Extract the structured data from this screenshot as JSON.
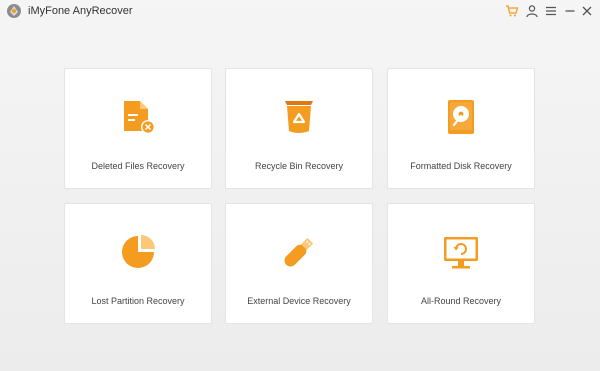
{
  "window": {
    "title": "iMyFone AnyRecover"
  },
  "titlebar": {
    "icons": [
      "cart-icon",
      "user-icon",
      "menu-icon",
      "minimize-icon",
      "close-icon"
    ]
  },
  "colors": {
    "accent": "#f39c1f",
    "accent_dark": "#e0760f",
    "card_bg": "#ffffff",
    "window_bg": "#ececec"
  },
  "modes": [
    {
      "label": "Deleted Files Recovery",
      "icon": "deleted-file-icon"
    },
    {
      "label": "Recycle Bin Recovery",
      "icon": "recycle-bin-icon"
    },
    {
      "label": "Formatted Disk Recovery",
      "icon": "formatted-disk-icon"
    },
    {
      "label": "Lost Partition Recovery",
      "icon": "pie-partition-icon"
    },
    {
      "label": "External Device Recovery",
      "icon": "usb-drive-icon"
    },
    {
      "label": "All-Round Recovery",
      "icon": "monitor-refresh-icon"
    }
  ]
}
